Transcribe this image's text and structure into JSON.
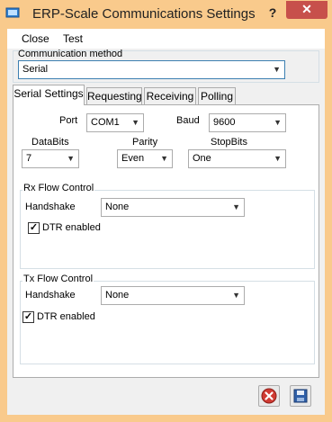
{
  "window": {
    "title": "ERP-Scale Communications Settings",
    "help": "?",
    "close": "✕"
  },
  "menu": {
    "close": "Close",
    "test": "Test"
  },
  "communication_method": {
    "label": "Communication method",
    "value": "Serial"
  },
  "tabs": [
    {
      "label": "Serial Settings",
      "active": true
    },
    {
      "label": "Requesting",
      "active": false
    },
    {
      "label": "Receiving",
      "active": false
    },
    {
      "label": "Polling",
      "active": false
    }
  ],
  "serial": {
    "port_label": "Port",
    "port_value": "COM1",
    "baud_label": "Baud",
    "baud_value": "9600",
    "databits_label": "DataBits",
    "databits_value": "7",
    "parity_label": "Parity",
    "parity_value": "Even",
    "stopbits_label": "StopBits",
    "stopbits_value": "One"
  },
  "rx": {
    "title": "Rx Flow Control",
    "handshake_label": "Handshake",
    "handshake_value": "None",
    "dtr_label": "DTR enabled",
    "dtr_checked": true
  },
  "tx": {
    "title": "Tx Flow Control",
    "handshake_label": "Handshake",
    "handshake_value": "None",
    "dtr_label": "DTR enabled",
    "dtr_checked": true
  },
  "colors": {
    "titlebar": "#f9ca8c",
    "close_button": "#c7504b",
    "cancel_icon": "#d03a32",
    "save_icon": "#2f5fa8"
  },
  "icons": {
    "cancel": "cancel-icon",
    "save": "save-icon",
    "app": "app-icon"
  }
}
